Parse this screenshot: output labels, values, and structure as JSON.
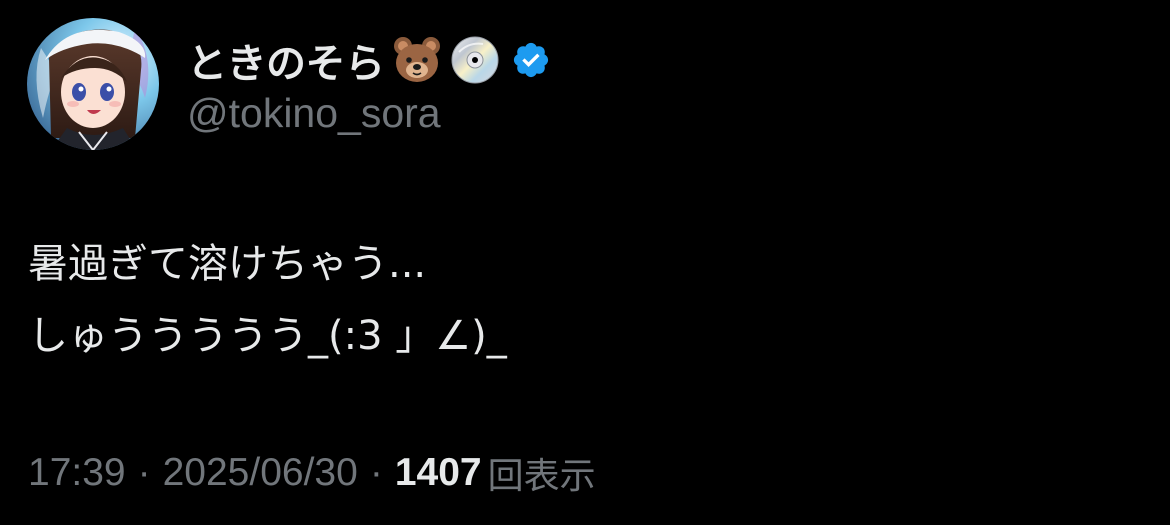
{
  "user": {
    "display_name": "ときのそら",
    "handle": "@tokino_sora",
    "badges": [
      "bear-emoji",
      "disc-emoji",
      "verified-badge-icon"
    ],
    "verified_color": "#1d9bf0"
  },
  "tweet": {
    "lines": [
      "暑過ぎて溶けちゃう...",
      "しゅううううう_(:3 」∠)_"
    ]
  },
  "meta": {
    "time": "17:39",
    "separator": "·",
    "date": "2025/06/30",
    "views_count": "1407",
    "views_label": "回表示"
  },
  "colors": {
    "background": "#000000",
    "primary_text": "#e7e9ea",
    "secondary_text": "#71767b"
  }
}
